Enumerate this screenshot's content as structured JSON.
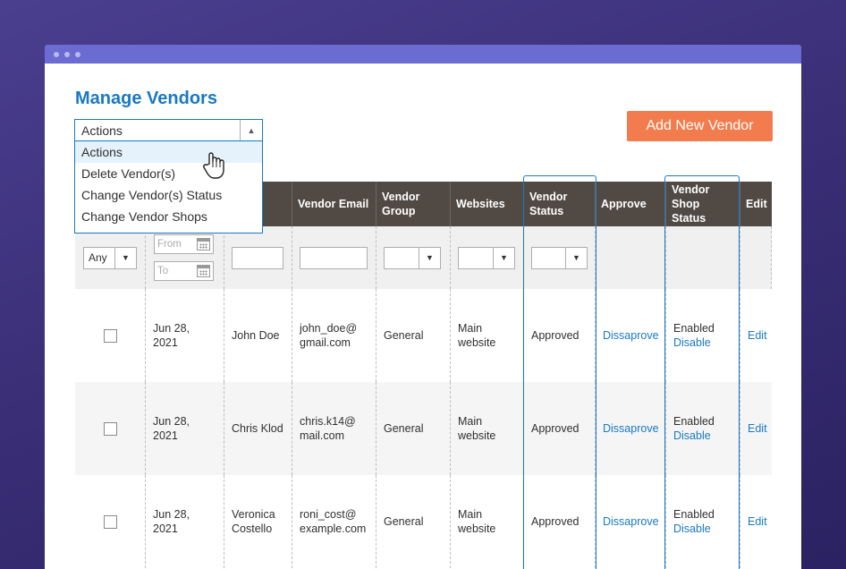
{
  "page": {
    "title": "Manage Vendors",
    "add_button": "Add New Vendor"
  },
  "actions": {
    "selected": "Actions",
    "options": [
      "Actions",
      "Delete Vendor(s)",
      "Change Vendor(s) Status",
      "Change Vendor Shops"
    ]
  },
  "columns": [
    "",
    "",
    "",
    "Vendor Email",
    "Vendor Group",
    "Websites",
    "Vendor Status",
    "Approve",
    "Vendor Shop Status",
    "Edit"
  ],
  "filters": {
    "any": "Any",
    "from": "From",
    "to": "To"
  },
  "rows": [
    {
      "date": "Jun 28, 2021",
      "name": "John Doe",
      "email": "john_doe@ gmail.com",
      "group": "General",
      "website": "Main website",
      "status": "Approved",
      "approve": "Dissaprove",
      "shop_status": "Enabled",
      "shop_action": "Disable",
      "edit": "Edit"
    },
    {
      "date": "Jun 28, 2021",
      "name": "Chris Klod",
      "email": "chris.k14@ mail.com",
      "group": "General",
      "website": "Main website",
      "status": "Approved",
      "approve": "Dissaprove",
      "shop_status": "Enabled",
      "shop_action": "Disable",
      "edit": "Edit"
    },
    {
      "date": "Jun 28, 2021",
      "name": "Veronica Costello",
      "email": "roni_cost@ example.com",
      "group": "General",
      "website": "Main website",
      "status": "Approved",
      "approve": "Dissaprove",
      "shop_status": "Enabled",
      "shop_action": "Disable",
      "edit": "Edit"
    }
  ],
  "colors": {
    "accent": "#1979c3",
    "button": "#f27c4e",
    "header": "#514943",
    "titlebar": "#6b6bd1"
  }
}
